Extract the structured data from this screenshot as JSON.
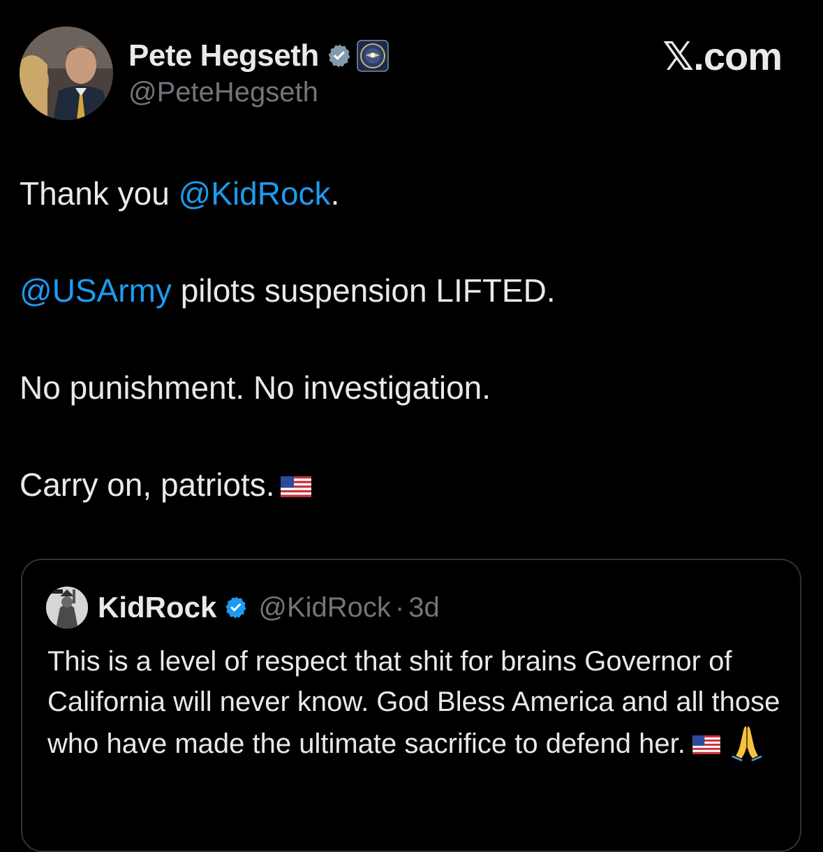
{
  "author": {
    "display_name": "Pete Hegseth",
    "handle": "@PeteHegseth",
    "verified": true,
    "affiliate_badge": "department-seal-icon"
  },
  "brand": {
    "label": "𝕏.com"
  },
  "tweet": {
    "line1": {
      "text": "Thank you ",
      "mention": "@KidRock",
      "after": "."
    },
    "line2": {
      "mention": "@USArmy",
      "text": " pilots suspension LIFTED."
    },
    "line3": {
      "text": "No punishment. No investigation."
    },
    "line4": {
      "text": "Carry on, patriots.",
      "emoji": "us-flag-icon"
    }
  },
  "quoted": {
    "display_name": "KidRock",
    "handle": "@KidRock",
    "separator": "·",
    "time": "3d",
    "verified": true,
    "text": "This is a level of respect that shit for brains Governor of California will never know. God Bless America and all those who have made the ultimate sacrifice to defend her.",
    "emojis": [
      "us-flag-icon",
      "folded-hands-icon"
    ]
  },
  "colors": {
    "background": "#000000",
    "text": "#e7e9ea",
    "secondary": "#71767b",
    "link": "#1d9bf0",
    "border": "#2f3336"
  }
}
